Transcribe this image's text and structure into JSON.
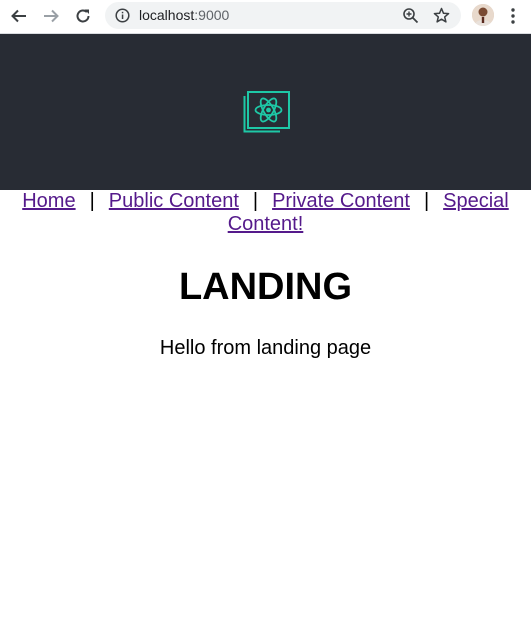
{
  "browser": {
    "url_host": "localhost",
    "url_port": ":9000",
    "icons": [
      "back-arrow-icon",
      "forward-arrow-icon",
      "reload-icon",
      "info-icon",
      "zoom-icon",
      "star-icon",
      "kebab-menu-icon"
    ]
  },
  "header": {
    "logo_icon": "react-logo-icon",
    "accent_color": "#1ec8a6",
    "background_color": "#282c34"
  },
  "nav": {
    "links": [
      "Home",
      "Public Content",
      "Private Content",
      "Special Content!"
    ],
    "separator": "|",
    "link_color": "#551a8b"
  },
  "main": {
    "title": "LANDING",
    "message": "Hello from landing page"
  }
}
